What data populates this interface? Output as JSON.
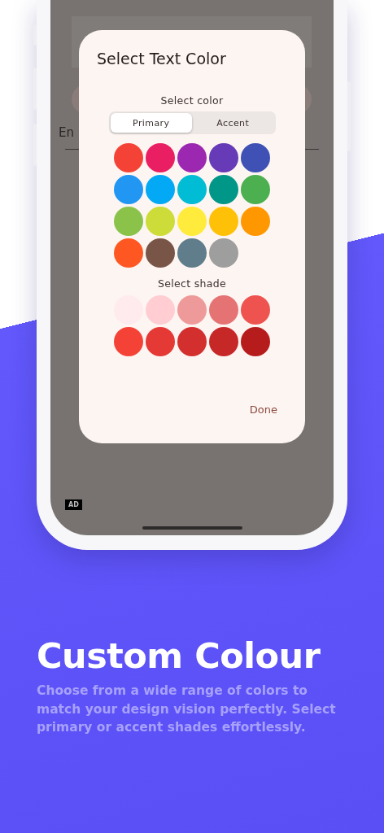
{
  "screen": {
    "background": {
      "field_label": "En"
    },
    "dialog": {
      "title": "Select Text Color",
      "color_label": "Select color",
      "tabs": [
        {
          "label": "Primary",
          "selected": true
        },
        {
          "label": "Accent",
          "selected": false
        }
      ],
      "colors": [
        {
          "color": "#f44336"
        },
        {
          "color": "#e91e63"
        },
        {
          "color": "#9c27b0"
        },
        {
          "color": "#673ab7"
        },
        {
          "color": "#3f51b5"
        },
        {
          "color": "#2196f3"
        },
        {
          "color": "#03a9f4"
        },
        {
          "color": "#00bcd4"
        },
        {
          "color": "#009688"
        },
        {
          "color": "#4caf50"
        },
        {
          "color": "#8bc34a"
        },
        {
          "color": "#cddc39"
        },
        {
          "color": "#ffeb3b"
        },
        {
          "color": "#ffc107"
        },
        {
          "color": "#ff9800"
        },
        {
          "color": "#ff5722"
        },
        {
          "color": "#795548"
        },
        {
          "color": "#607d8b"
        },
        {
          "color": "#9e9e9e"
        }
      ],
      "shade_label": "Select shade",
      "shades": [
        {
          "color": "#ffebee"
        },
        {
          "color": "#ffcdd2"
        },
        {
          "color": "#ef9a9a"
        },
        {
          "color": "#e57373"
        },
        {
          "color": "#ef5350"
        },
        {
          "color": "#f44336"
        },
        {
          "color": "#e53935"
        },
        {
          "color": "#d32f2f"
        },
        {
          "color": "#c62828"
        },
        {
          "color": "#b71c1c"
        }
      ],
      "done": "Done"
    },
    "ad_badge": "AD"
  },
  "caption": {
    "title": "Custom Colour",
    "description": "Choose from a wide range of colors to match your design vision perfectly. Select primary or accent shades effortlessly."
  }
}
